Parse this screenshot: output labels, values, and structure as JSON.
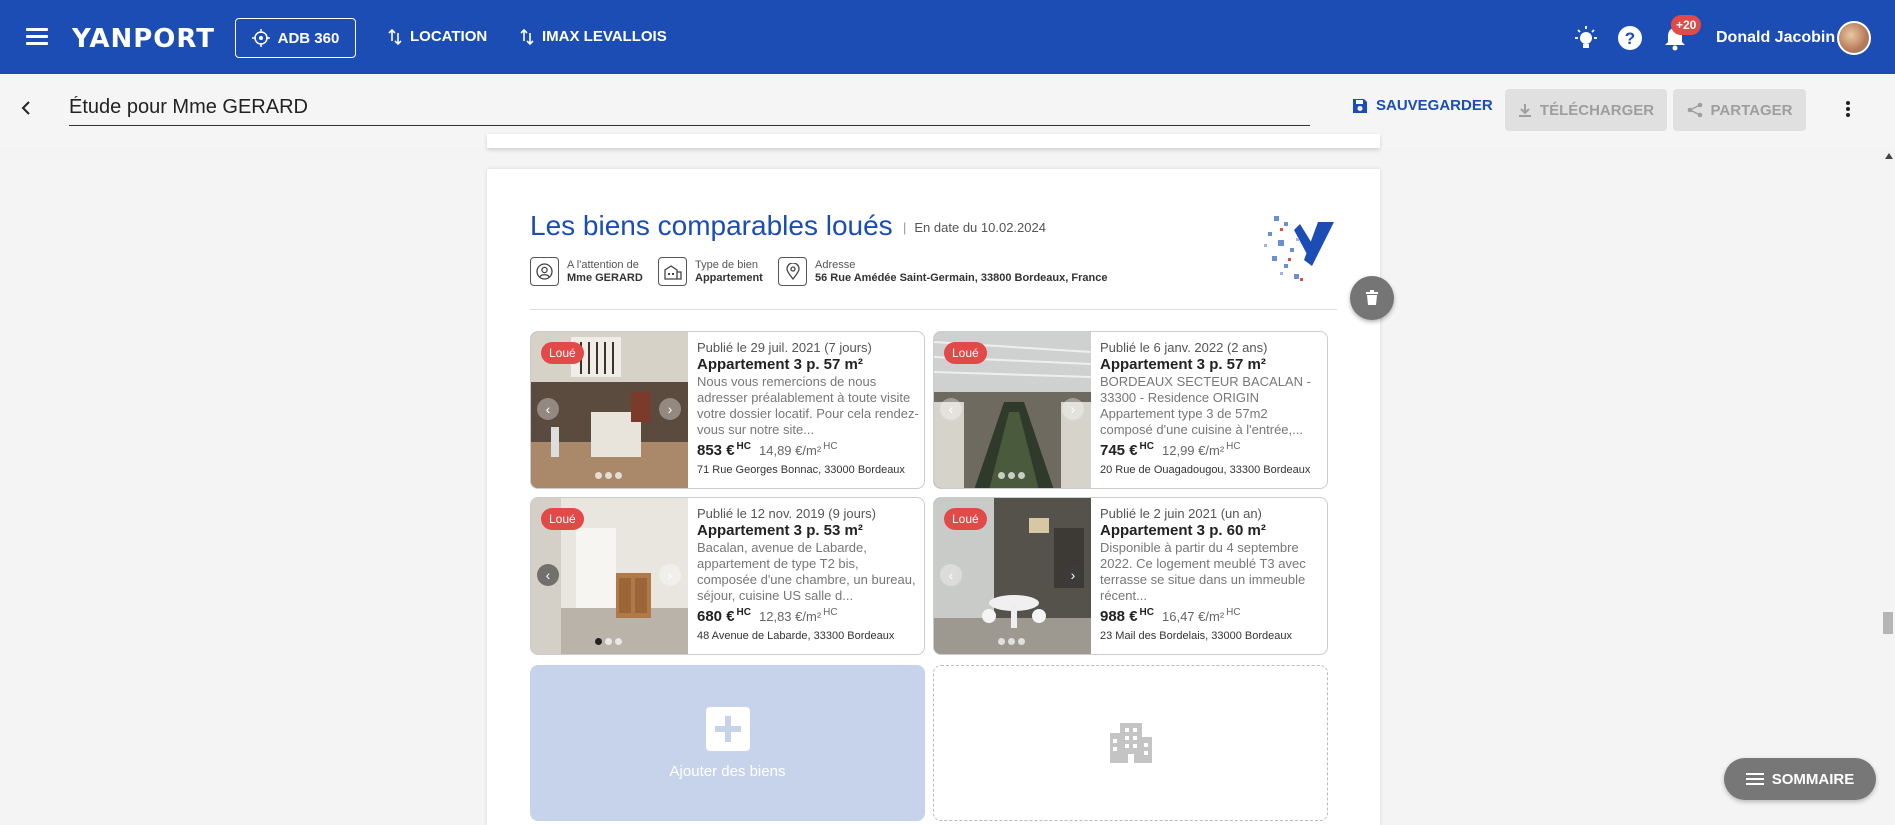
{
  "topbar": {
    "logo_text": "YANPORT",
    "adb_label": "ADB 360",
    "location_label": "LOCATION",
    "agency_label": "IMAX LEVALLOIS",
    "notif_count": "+20",
    "user_name": "Donald Jacobin",
    "bg_color": "#1b4db4"
  },
  "subheader": {
    "study_title": "Étude pour Mme GERARD",
    "save_label": "SAUVEGARDER",
    "download_label": "TÉLÉCHARGER",
    "share_label": "PARTAGER"
  },
  "section": {
    "title": "Les biens comparables loués",
    "date": "En date du 10.02.2024",
    "attention_label": "A l'attention de",
    "attention_value": "Mme GERARD",
    "type_label": "Type de bien",
    "type_value": "Appartement",
    "address_label": "Adresse",
    "address_value": "56 Rue Amédée Saint-Germain, 33800 Bordeaux, France"
  },
  "badge_label": "Loué",
  "price_unit": "HC",
  "cards": [
    {
      "published": "Publié le 29 juil. 2021 (7 jours)",
      "title": "Appartement 3 p. 57 m²",
      "description": "Nous vous remercions de nous adresser préalablement à toute visite votre dossier locatif. Pour cela rendez-vous sur notre site...",
      "price": "853 €",
      "price_m2": "14,89 €/m²",
      "address": "71 Rue Georges Bonnac, 33000 Bordeaux"
    },
    {
      "published": "Publié le 6 janv. 2022 (2 ans)",
      "title": "Appartement 3 p. 57 m²",
      "description": "BORDEAUX SECTEUR BACALAN - 33300 - Residence ORIGIN Appartement type 3 de 57m2 composé d'une cuisine à l'entrée,...",
      "price": "745 €",
      "price_m2": "12,99 €/m²",
      "address": "20 Rue de Ouagadougou, 33300 Bordeaux"
    },
    {
      "published": "Publié le 12 nov. 2019 (9 jours)",
      "title": "Appartement 3 p. 53 m²",
      "description": "Bacalan, avenue de Labarde, appartement de type T2 bis, composée d'une chambre, un bureau, séjour, cuisine US salle d...",
      "price": "680 €",
      "price_m2": "12,83 €/m²",
      "address": "48 Avenue de Labarde, 33300 Bordeaux"
    },
    {
      "published": "Publié le 2 juin 2021 (un an)",
      "title": "Appartement 3 p. 60 m²",
      "description": "Disponible à partir du 4 septembre 2022. Ce logement meublé T3 avec terrasse se situe dans un immeuble récent...",
      "price": "988 €",
      "price_m2": "16,47 €/m²",
      "address": "23 Mail des Bordelais, 33000 Bordeaux"
    }
  ],
  "add_label": "Ajouter des biens",
  "sommaire_label": "SOMMAIRE"
}
